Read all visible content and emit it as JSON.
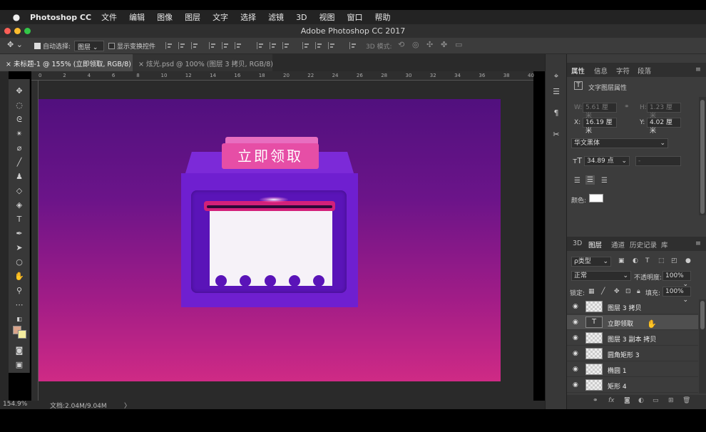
{
  "menubar": {
    "app": "Photoshop CC",
    "items": [
      "文件",
      "编辑",
      "图像",
      "图层",
      "文字",
      "选择",
      "滤镜",
      "3D",
      "视图",
      "窗口",
      "帮助"
    ]
  },
  "window": {
    "title": "Adobe Photoshop CC 2017"
  },
  "options": {
    "auto_select_label": "自动选择:",
    "auto_select_value": "图层",
    "show_transform_label": "显示变换控件",
    "mode_3d_label": "3D 模式:"
  },
  "tabs": [
    {
      "label": "未标题-1 @ 155% (立即领取, RGB/8) *",
      "close": "×"
    },
    {
      "label": "炫光.psd @ 100% (图层 3 拷贝, RGB/8)",
      "close": "×"
    }
  ],
  "ruler": {
    "ticks": [
      "0",
      "2",
      "4",
      "6",
      "8",
      "10",
      "12",
      "14",
      "16",
      "18",
      "20",
      "22",
      "24",
      "26",
      "28",
      "30",
      "32",
      "34",
      "36",
      "38",
      "40"
    ]
  },
  "canvas": {
    "banner_text": "立即领取"
  },
  "status": {
    "zoom": "154.9%",
    "doc_info": "文档:2.04M/9.04M",
    "arrow": "〉"
  },
  "properties_panel": {
    "tabs": [
      "属性",
      "信息",
      "字符",
      "段落"
    ],
    "header": "文字图层属性",
    "w_label": "W:",
    "w_value": "5.61 厘米",
    "h_label": "H:",
    "h_value": "1.23 厘米",
    "x_label": "X:",
    "x_value": "16.19 厘米",
    "y_label": "Y:",
    "y_value": "4.02 厘米",
    "font": "华文黑体",
    "font_size": "34.89 点",
    "font_style": "-",
    "color_label": "颜色:",
    "color_swatch": "#ffffff"
  },
  "layers_panel": {
    "tabs": [
      "3D",
      "图层",
      "通道",
      "历史记录",
      "库"
    ],
    "filter_label": "ρ类型",
    "blend_mode": "正常",
    "opacity_label": "不透明度:",
    "opacity_value": "100%",
    "lock_label": "锁定:",
    "fill_label": "填充:",
    "fill_value": "100%",
    "layers": [
      {
        "name": "图层 3 拷贝",
        "type": "pixel",
        "selected": false
      },
      {
        "name": "立即领取",
        "type": "text",
        "selected": true
      },
      {
        "name": "图层 3 副本 拷贝",
        "type": "pixel",
        "selected": false
      },
      {
        "name": "圆角矩形 3",
        "type": "shape",
        "selected": false
      },
      {
        "name": "椭圆 1",
        "type": "pixel",
        "selected": false
      },
      {
        "name": "矩形 4",
        "type": "shape",
        "selected": false
      }
    ]
  },
  "colors": {
    "foreground": "#d9a48a",
    "background": "#f3ec9e",
    "banner": "#e64ea6",
    "box": "#6f1fd0"
  }
}
